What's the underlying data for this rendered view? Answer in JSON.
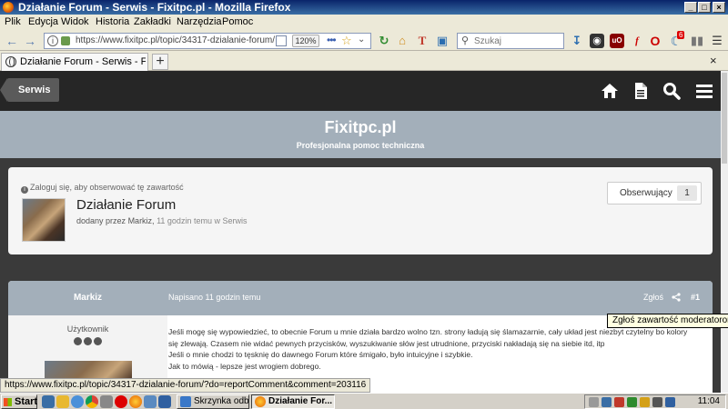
{
  "window": {
    "title": "Działanie Forum - Serwis - Fixitpc.pl - Mozilla Firefox",
    "minimize": "_",
    "maximize": "□",
    "close": "×"
  },
  "menu": [
    "Plik",
    "Edycja",
    "Widok",
    "Historia",
    "Zakładki",
    "Narzędzia",
    "Pomoc"
  ],
  "navbar": {
    "url": "https://www.fixitpc.pl/topic/34317-dzialanie-forum/",
    "zoom": "120%",
    "search_placeholder": "Szukaj",
    "ext_badge": "6"
  },
  "tab": {
    "title": "Działanie Forum - Serwis - Fixitpc.pl",
    "new_tab": "+",
    "close_all": "×"
  },
  "site": {
    "back_label": "Serwis",
    "name": "Fixitpc.pl",
    "tagline": "Profesjonalna pomoc techniczna"
  },
  "topic": {
    "follow_note": "Zaloguj się, aby obserwować tę zawartość",
    "title": "Działanie Forum",
    "meta_prefix": "dodany przez",
    "meta_author": "Markiz,",
    "meta_time": "11 godzin temu",
    "meta_in": "w",
    "meta_forum": "Serwis",
    "follow_label": "Obserwujący",
    "follow_count": "1"
  },
  "post": {
    "author": "Markiz",
    "date": "Napisano 11 godzin temu",
    "report": "Zgłoś",
    "number": "#1",
    "role": "Użytkownik",
    "body": [
      "Jeśli mogę się wypowiedzieć, to obecnie Forum u mnie działa bardzo wolno tzn. strony ładują się ślamazarnie, cały układ jest niezbyt czytelny bo kolory",
      "się zlewają. Czasem nie widać pewnych przycisków, wyszukiwanie słów jest utrudnione, przyciski nakładają się na siebie itd, itp",
      "Jeśli o mnie chodzi to tęsknię do dawnego Forum które śmigało, było intuicyjne i szybkie.",
      "Jak to mówią - lepsze jest wrogiem dobrego."
    ]
  },
  "tooltip": "Zgłoś zawartość moderatorom",
  "status_url": "https://www.fixitpc.pl/topic/34317-dzialanie-forum/?do=reportComment&comment=203116",
  "taskbar": {
    "start": "Start",
    "tasks": [
      "Skrzynka odbio...",
      "Działanie For..."
    ],
    "clock": "11:04"
  }
}
